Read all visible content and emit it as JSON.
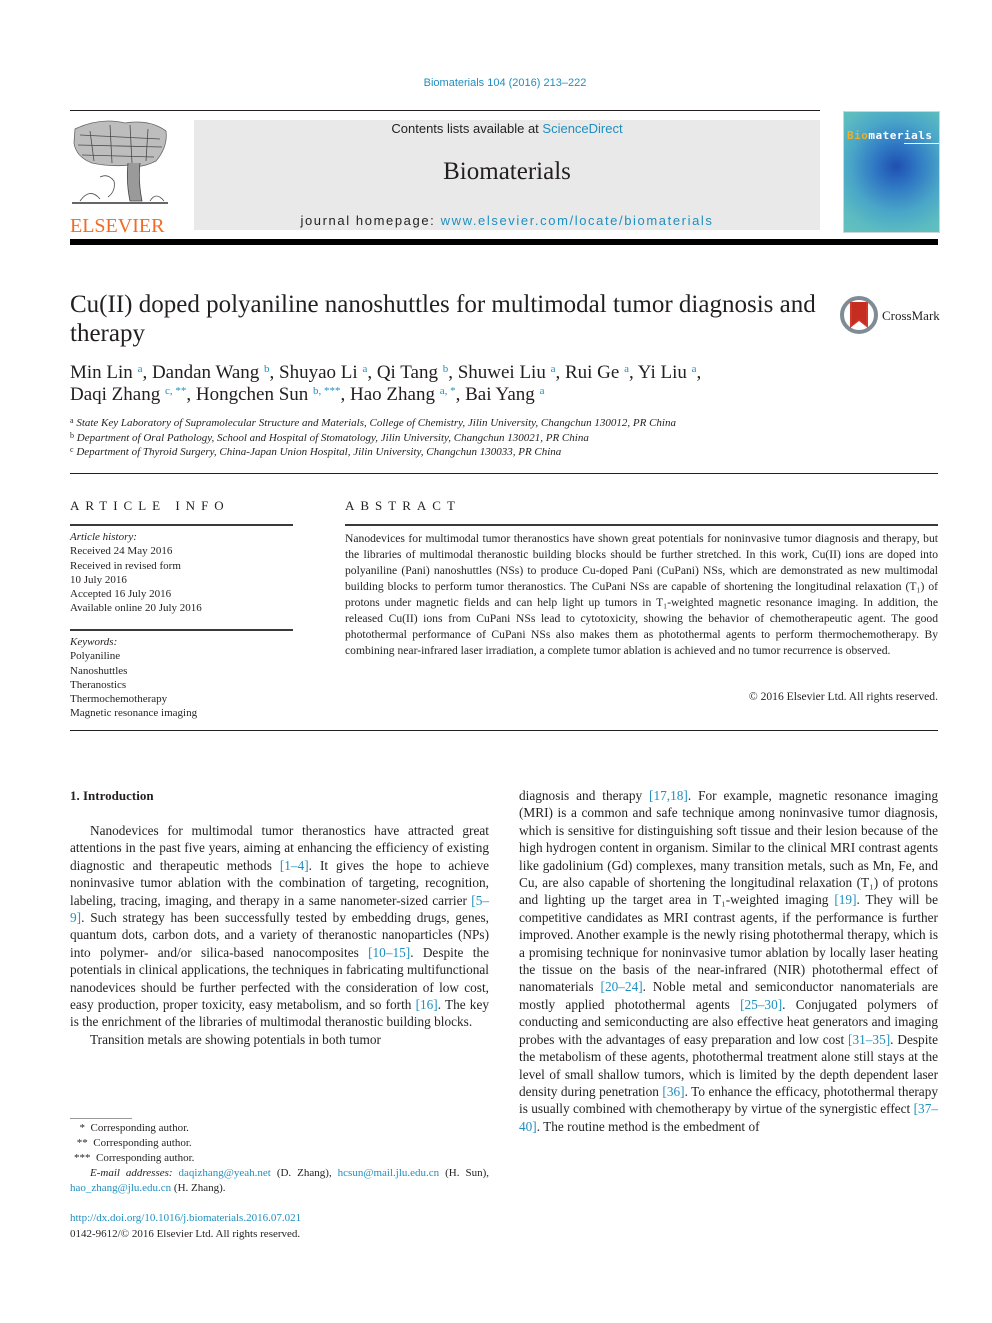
{
  "header": {
    "journal_ref": "Biomaterials 104 (2016) 213–222",
    "contents_prefix": "Contents lists available at ",
    "contents_link": "ScienceDirect",
    "journal_name": "Biomaterials",
    "homepage_prefix": "journal homepage: ",
    "homepage_link": "www.elsevier.com/locate/biomaterials",
    "publisher_logo_text": "ELSEVIER",
    "cover_title_bio": "Bio",
    "cover_title_rest": "materials",
    "brand_colors": {
      "link": "#1f8fbf",
      "elsevier_orange": "#f26b21"
    }
  },
  "article": {
    "title": "Cu(II) doped polyaniline nanoshuttles for multimodal tumor diagnosis and therapy",
    "crossmark_label": "CrossMark",
    "authors": [
      {
        "name": "Min Lin",
        "sup": "a"
      },
      {
        "name": "Dandan Wang",
        "sup": "b"
      },
      {
        "name": "Shuyao Li",
        "sup": "a"
      },
      {
        "name": "Qi Tang",
        "sup": "b"
      },
      {
        "name": "Shuwei Liu",
        "sup": "a"
      },
      {
        "name": "Rui Ge",
        "sup": "a"
      },
      {
        "name": "Yi Liu",
        "sup": "a"
      },
      {
        "name": "Daqi Zhang",
        "sup": "c, **"
      },
      {
        "name": "Hongchen Sun",
        "sup": "b, ***"
      },
      {
        "name": "Hao Zhang",
        "sup": "a, *"
      },
      {
        "name": "Bai Yang",
        "sup": "a"
      }
    ],
    "affiliations": [
      {
        "key": "a",
        "text": "State Key Laboratory of Supramolecular Structure and Materials, College of Chemistry, Jilin University, Changchun 130012, PR China"
      },
      {
        "key": "b",
        "text": "Department of Oral Pathology, School and Hospital of Stomatology, Jilin University, Changchun 130021, PR China"
      },
      {
        "key": "c",
        "text": "Department of Thyroid Surgery, China-Japan Union Hospital, Jilin University, Changchun 130033, PR China"
      }
    ]
  },
  "article_info": {
    "heading": "ARTICLE INFO",
    "history_label": "Article history:",
    "history": [
      "Received 24 May 2016",
      "Received in revised form",
      "10 July 2016",
      "Accepted 16 July 2016",
      "Available online 20 July 2016"
    ],
    "keywords_label": "Keywords:",
    "keywords": [
      "Polyaniline",
      "Nanoshuttles",
      "Theranostics",
      "Thermochemotherapy",
      "Magnetic resonance imaging"
    ]
  },
  "abstract": {
    "heading": "ABSTRACT",
    "body": "Nanodevices for multimodal tumor theranostics have shown great potentials for noninvasive tumor diagnosis and therapy, but the libraries of multimodal theranostic building blocks should be further stretched. In this work, Cu(II) ions are doped into polyaniline (Pani) nanoshuttles (NSs) to produce Cu-doped Pani (CuPani) NSs, which are demonstrated as new multimodal building blocks to perform tumor theranostics. The CuPani NSs are capable of shortening the longitudinal relaxation (T₁) of protons under magnetic fields and can help light up tumors in T₁-weighted magnetic resonance imaging. In addition, the released Cu(II) ions from CuPani NSs lead to cytotoxicity, showing the behavior of chemotherapeutic agent. The good photothermal performance of CuPani NSs also makes them as photothermal agents to perform thermochemotherapy. By combining near-infrared laser irradiation, a complete tumor ablation is achieved and no tumor recurrence is observed.",
    "copyright": "© 2016 Elsevier Ltd. All rights reserved."
  },
  "introduction": {
    "heading": "1.  Introduction",
    "left_p1": [
      {
        "t": "Nanodevices for multimodal tumor theranostics have attracted great attentions in the past five years, aiming at enhancing the efficiency of existing diagnostic and therapeutic methods "
      },
      {
        "ref": "[1–4]"
      },
      {
        "t": ". It gives the hope to achieve noninvasive tumor ablation with the combination of targeting, recognition, labeling, tracing, imaging, and therapy in a same nanometer-sized carrier "
      },
      {
        "ref": "[5–9]"
      },
      {
        "t": ". Such strategy has been successfully tested by embedding drugs, genes, quantum dots, carbon dots, and a variety of theranostic nanoparticles (NPs) into polymer- and/or silica-based nanocomposites "
      },
      {
        "ref": "[10–15]"
      },
      {
        "t": ". Despite the potentials in clinical applications, the techniques in fabricating multifunctional nanodevices should be further perfected with the consideration of low cost, easy production, proper toxicity, easy metabolism, and so forth "
      },
      {
        "ref": "[16]"
      },
      {
        "t": ". The key is the enrichment of the libraries of multimodal theranostic building blocks."
      }
    ],
    "left_p2": "Transition metals are showing potentials in both tumor",
    "right_p": [
      {
        "t": "diagnosis and therapy "
      },
      {
        "ref": "[17,18]"
      },
      {
        "t": ". For example, magnetic resonance imaging (MRI) is a common and safe technique among noninvasive tumor diagnosis, which is sensitive for distinguishing soft tissue and their lesion because of the high hydrogen content in organism. Similar to the clinical MRI contrast agents like gadolinium (Gd) complexes, many transition metals, such as Mn, Fe, and Cu, are also capable of shortening the longitudinal relaxation (T₁) of protons and lighting up the target area in T₁-weighted imaging "
      },
      {
        "ref": "[19]"
      },
      {
        "t": ". They will be competitive candidates as MRI contrast agents, if the performance is further improved. Another example is the newly rising photothermal therapy, which is a promising technique for noninvasive tumor ablation by locally laser heating the tissue on the basis of the near-infrared (NIR) photothermal effect of nanomaterials "
      },
      {
        "ref": "[20–24]"
      },
      {
        "t": ". Noble metal and semiconductor nanomaterials are mostly applied photothermal agents "
      },
      {
        "ref": "[25–30]"
      },
      {
        "t": ". Conjugated polymers of conducting and semiconducting are also effective heat generators and imaging probes with the advantages of easy preparation and low cost "
      },
      {
        "ref": "[31–35]"
      },
      {
        "t": ". Despite the metabolism of these agents, photothermal treatment alone still stays at the level of small shallow tumors, which is limited by the depth dependent laser density during penetration "
      },
      {
        "ref": "[36]"
      },
      {
        "t": ". To enhance the efficacy, photothermal therapy is usually combined with chemotherapy by virtue of the synergistic effect "
      },
      {
        "ref": "[37–40]"
      },
      {
        "t": ". The routine method is the embedment of"
      }
    ]
  },
  "footnotes": {
    "corresponding": [
      {
        "mark": "*",
        "text": "Corresponding author."
      },
      {
        "mark": "**",
        "text": "Corresponding author."
      },
      {
        "mark": "***",
        "text": "Corresponding author."
      }
    ],
    "email_label": "E-mail addresses:",
    "emails": [
      {
        "addr": "daqizhang@yeah.net",
        "who": "(D. Zhang)"
      },
      {
        "addr": "hcsun@mail.jlu.edu.cn",
        "who": "(H. Sun)"
      },
      {
        "addr": "hao_zhang@jlu.edu.cn",
        "who": "(H. Zhang)."
      }
    ],
    "doi": "http://dx.doi.org/10.1016/j.biomaterials.2016.07.021",
    "issn_copyright": "0142-9612/© 2016 Elsevier Ltd. All rights reserved."
  }
}
